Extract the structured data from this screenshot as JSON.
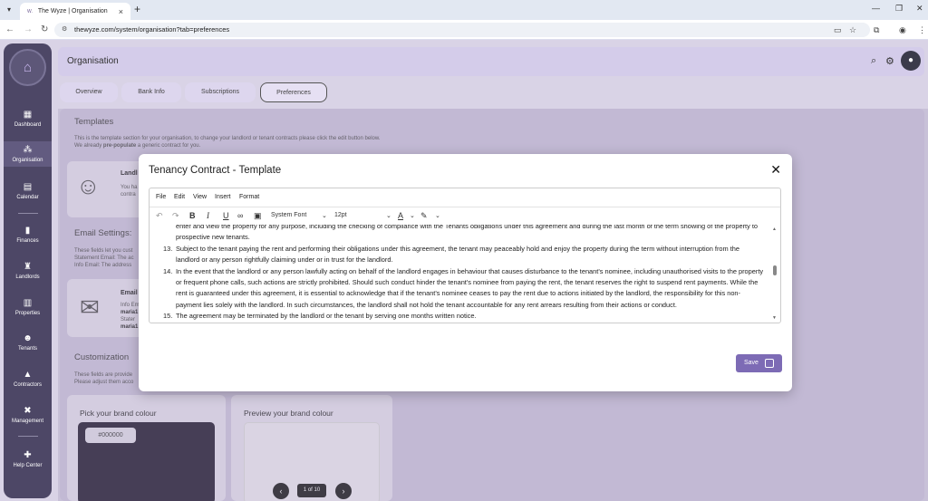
{
  "browser": {
    "tab_title": "The Wyze | Organisation",
    "favicon_text": "W.",
    "url": "thewyze.com/system/organisation?tab=preferences"
  },
  "sidebar": {
    "items": [
      {
        "label": "Dashboard",
        "icon": "dashboard-icon"
      },
      {
        "label": "Organisation",
        "icon": "organisation-icon"
      },
      {
        "label": "Calendar",
        "icon": "calendar-icon"
      },
      {
        "label": "Finances",
        "icon": "finances-icon"
      },
      {
        "label": "Landlords",
        "icon": "landlords-icon"
      },
      {
        "label": "Properties",
        "icon": "properties-icon"
      },
      {
        "label": "Tenants",
        "icon": "tenants-icon"
      },
      {
        "label": "Contractors",
        "icon": "contractors-icon"
      },
      {
        "label": "Management",
        "icon": "management-icon"
      },
      {
        "label": "Help Center",
        "icon": "help-icon"
      }
    ]
  },
  "header": {
    "title": "Organisation"
  },
  "tabs": [
    "Overview",
    "Bank Info",
    "Subscriptions",
    "Preferences"
  ],
  "page": {
    "templates_title": "Templates",
    "templates_desc": "This is the template section for your organisation, to change your landlord or tenant contracts please click the edit button below.",
    "templates_desc2_a": "We already ",
    "templates_desc2_b": "pre-populate",
    "templates_desc2_c": " a generic contract for you.",
    "card1_title": "Landl",
    "card1_text1": "You ha",
    "card1_text2": "contra",
    "email_title": "Email Settings:",
    "email_l1": "These fields let you cust",
    "email_l2": "Statement Email: The ac",
    "email_l3": "Info Email: The address",
    "email_card_title": "Email",
    "email_card_l1": "Info Em",
    "email_card_l2": "maria1",
    "email_card_l3": "Stater",
    "email_card_l4": "maria1",
    "custom_title": "Customization",
    "custom_l1": "These fields are provide",
    "custom_l2": "Please adjust them acco",
    "pick_colour_title": "Pick your brand colour",
    "colour_value": "#000000",
    "preview_title": "Preview your brand colour",
    "pager": "1 of 10"
  },
  "modal": {
    "title": "Tenancy Contract - Template",
    "menu": [
      "File",
      "Edit",
      "View",
      "Insert",
      "Format"
    ],
    "font_family": "System Font",
    "font_size": "12pt",
    "save_label": "Save",
    "paragraphs": [
      {
        "num": "",
        "text": "enter and view the property for any purpose, including the checking of compliance with the Tenants obligations under this agreement and during the last month of the term showing of the property to prospective new tenants."
      },
      {
        "num": "13.",
        "text": "Subject to the tenant paying the rent and performing their obligations under this agreement, the tenant may peaceably hold and enjoy the property during the term without interruption from the landlord or any person rightfully claiming under or in trust for the landlord."
      },
      {
        "num": "14.",
        "text": "In the event that the landlord or any person lawfully acting on behalf of the landlord engages in behaviour that causes disturbance to the tenant's nominee, including unauthorised visits to the property or frequent phone calls, such actions are strictly prohibited. Should such conduct hinder the tenant's nominee from paying the rent, the tenant reserves the right to suspend rent payments. While the rent is guaranteed under this agreement, it is essential to acknowledge that if the tenant's nominee ceases to pay the rent due to actions initiated by the landlord, the responsibility for this non-payment lies solely with the landlord. In such circumstances, the landlord shall not hold the tenant accountable for any rent arrears resulting from their actions or conduct."
      },
      {
        "num": "15.",
        "text": "The agreement may be terminated by the landlord or the tenant by serving one months written notice."
      }
    ]
  },
  "colors": {
    "sidebar": "#4d4766",
    "accent": "#7d6bb5",
    "background": "#d9d3e6"
  }
}
